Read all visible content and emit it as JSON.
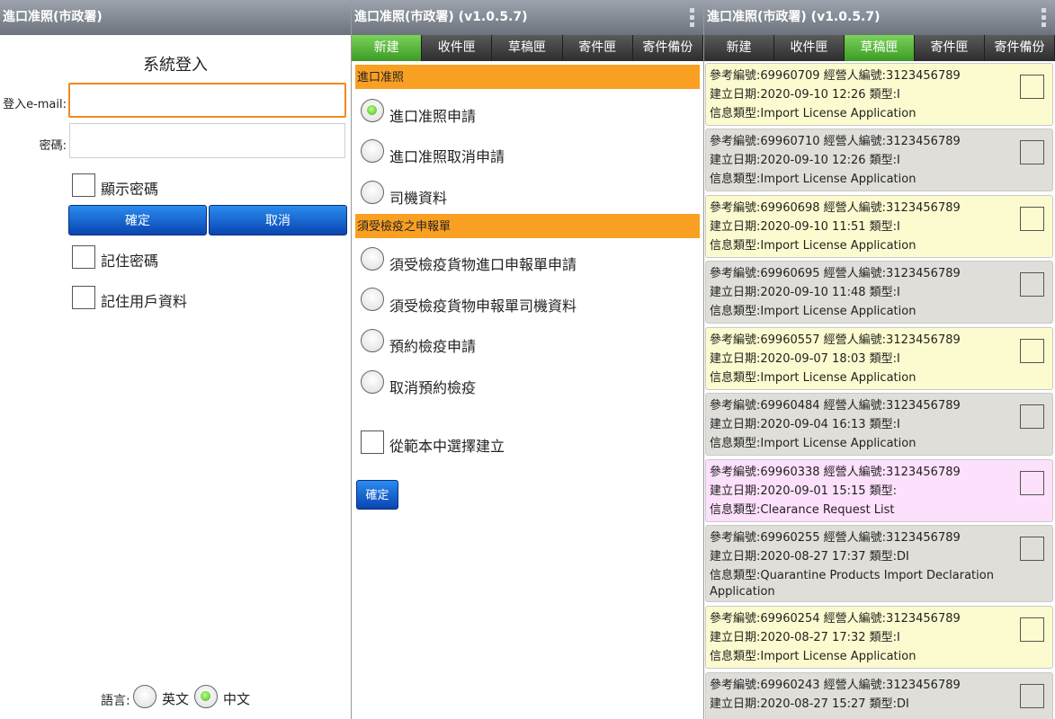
{
  "login": {
    "title_bar": "進口准照(市政署)",
    "heading": "系統登入",
    "email_label": "登入e-mail:",
    "email_value": "",
    "password_label": "密碼:",
    "password_value": "",
    "show_password": "顯示密碼",
    "confirm": "確定",
    "cancel": "取消",
    "remember_password": "記住密碼",
    "remember_user": "記住用戶資料",
    "language_label": "語言:",
    "lang_en": "英文",
    "lang_zh": "中文",
    "selected_language": "中文"
  },
  "new_form": {
    "title_bar": "進口准照(市政署) (v1.0.5.7)",
    "tabs": [
      "新建",
      "收件匣",
      "草稿匣",
      "寄件匣",
      "寄件備份"
    ],
    "active_tab": "新建",
    "section1": "進口准照",
    "options1": [
      "進口准照申請",
      "進口准照取消申請",
      "司機資料"
    ],
    "selected_option": "進口准照申請",
    "section2": "須受檢疫之申報單",
    "options2": [
      "須受檢疫貨物進口申報單申請",
      "須受檢疫貨物申報單司機資料",
      "預約檢疫申請",
      "取消預約檢疫"
    ],
    "template_checkbox": "從範本中選擇建立",
    "confirm": "確定"
  },
  "drafts": {
    "title_bar": "進口准照(市政署) (v1.0.5.7)",
    "tabs": [
      "新建",
      "收件匣",
      "草稿匣",
      "寄件匣",
      "寄件備份"
    ],
    "active_tab": "草稿匣",
    "items": [
      {
        "ref": "參考編號:69960709 經營人編號:3123456789",
        "date": "建立日期:2020-09-10 12:26 類型:I",
        "info": "信息類型:Import License Application",
        "info2": "",
        "color": "yellow"
      },
      {
        "ref": "參考編號:69960710 經營人編號:3123456789",
        "date": "建立日期:2020-09-10 12:26 類型:I",
        "info": "信息類型:Import License Application",
        "info2": "",
        "color": "gray"
      },
      {
        "ref": "參考編號:69960698 經營人編號:3123456789",
        "date": "建立日期:2020-09-10 11:51 類型:I",
        "info": "信息類型:Import License Application",
        "info2": "",
        "color": "yellow"
      },
      {
        "ref": "參考編號:69960695 經營人編號:3123456789",
        "date": "建立日期:2020-09-10 11:48 類型:I",
        "info": "信息類型:Import License Application",
        "info2": "",
        "color": "gray"
      },
      {
        "ref": "參考編號:69960557 經營人編號:3123456789",
        "date": "建立日期:2020-09-07 18:03 類型:I",
        "info": "信息類型:Import License Application",
        "info2": "",
        "color": "yellow"
      },
      {
        "ref": "參考編號:69960484 經營人編號:3123456789",
        "date": "建立日期:2020-09-04 16:13 類型:I",
        "info": "信息類型:Import License Application",
        "info2": "",
        "color": "gray"
      },
      {
        "ref": "參考編號:69960338 經營人編號:3123456789",
        "date": "建立日期:2020-09-01 15:15 類型:",
        "info": "信息類型:Clearance Request List",
        "info2": "",
        "color": "pink"
      },
      {
        "ref": "參考編號:69960255 經營人編號:3123456789",
        "date": "建立日期:2020-08-27 17:37 類型:DI",
        "info": "信息類型:Quarantine Products Import Declaration",
        "info2": "Application",
        "color": "gray"
      },
      {
        "ref": "參考編號:69960254 經營人編號:3123456789",
        "date": "建立日期:2020-08-27 17:32 類型:I",
        "info": "信息類型:Import License Application",
        "info2": "",
        "color": "yellow"
      },
      {
        "ref": "參考編號:69960243 經營人編號:3123456789",
        "date": "建立日期:2020-08-27 15:27 類型:DI",
        "info": "",
        "info2": "",
        "color": "gray"
      }
    ]
  }
}
